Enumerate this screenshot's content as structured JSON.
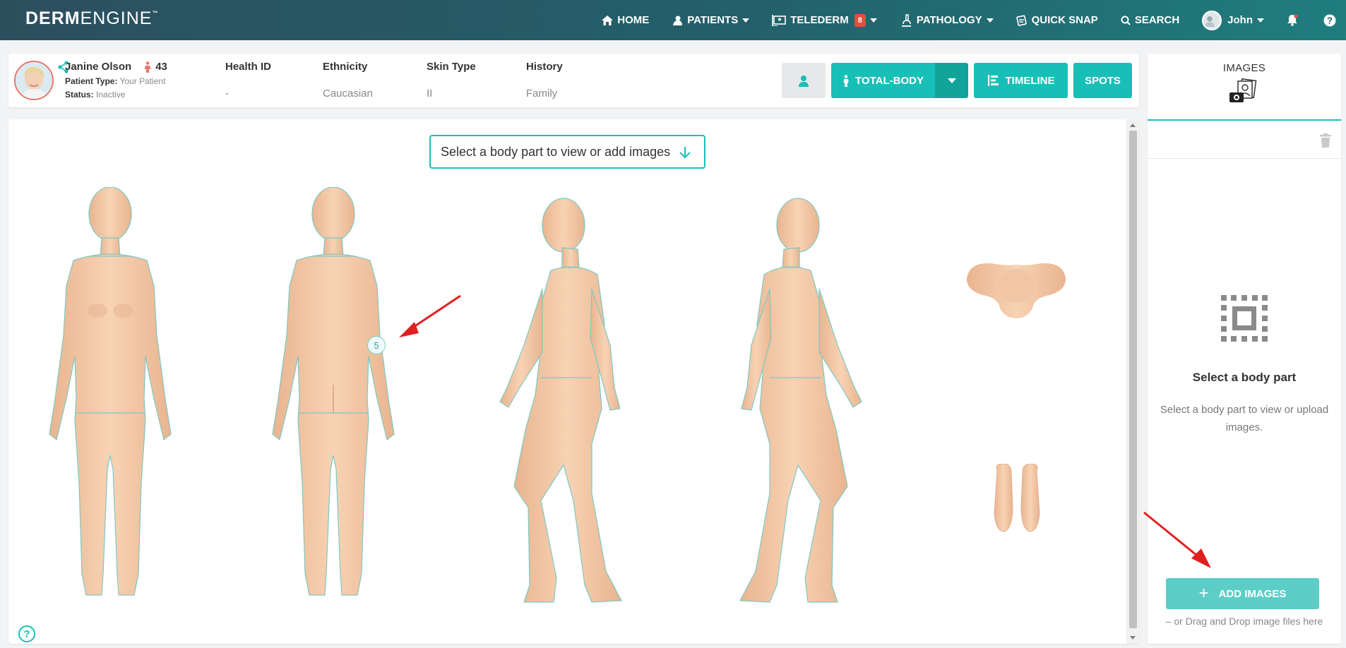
{
  "nav": {
    "logo_bold": "DERM",
    "logo_light": "ENGINE",
    "logo_tm": "™",
    "items": [
      {
        "label": "HOME",
        "icon": "home-icon"
      },
      {
        "label": "PATIENTS",
        "icon": "patients-icon",
        "dropdown": true
      },
      {
        "label": "TELEDERM",
        "icon": "telederm-icon",
        "badge": "8",
        "dropdown": true
      },
      {
        "label": "PATHOLOGY",
        "icon": "microscope-icon",
        "dropdown": true
      },
      {
        "label": "QUICK SNAP",
        "icon": "snap-icon"
      },
      {
        "label": "SEARCH",
        "icon": "search-icon"
      }
    ],
    "user": "John",
    "notification_icon": "bell-icon",
    "help_label": "?"
  },
  "patient": {
    "name": "Janine Olson",
    "age": "43",
    "type_label": "Patient Type:",
    "type_value": "Your Patient",
    "status_label": "Status:",
    "status_value": "Inactive",
    "fields": [
      {
        "label": "Health ID",
        "value": "-"
      },
      {
        "label": "Ethnicity",
        "value": "Caucasian"
      },
      {
        "label": "Skin Type",
        "value": "II"
      },
      {
        "label": "History",
        "value": "Family"
      }
    ]
  },
  "toolbar": {
    "total_body_label": "TOTAL-BODY",
    "timeline_label": "TIMELINE",
    "spots_label": "SPOTS"
  },
  "body_map": {
    "select_prompt": "Select a body part to view or add images",
    "views": [
      "front",
      "back",
      "right-side",
      "left-side",
      "top-head",
      "soles"
    ],
    "spot_count": "5",
    "help_label": "?"
  },
  "sidebar": {
    "tab_label": "IMAGES",
    "empty_title": "Select a body part",
    "empty_desc": "Select a body part to view or upload images.",
    "add_button": "ADD IMAGES",
    "drop_hint": "– or Drag and Drop image files here"
  },
  "colors": {
    "accent": "#18bfb6",
    "nav_start": "#2c4f5e",
    "nav_end": "#1f7d7e",
    "badge": "#e44f3b",
    "skin": "#f4cba8",
    "annotation_arrow": "#e02020"
  }
}
